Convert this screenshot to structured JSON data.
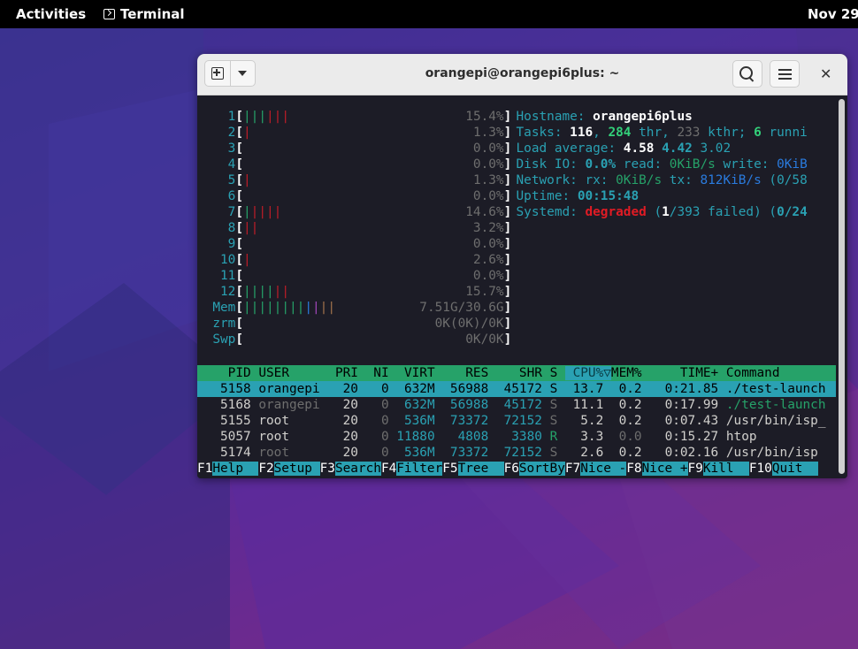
{
  "topbar": {
    "activities": "Activities",
    "app_name": "Terminal",
    "clock": "Nov 29"
  },
  "window": {
    "title": "orangepi@orangepi6plus: ~"
  },
  "cpus": [
    {
      "label": "1",
      "bars": [
        [
          "g",
          "|||"
        ],
        [
          "r",
          "|||"
        ]
      ],
      "pct": "15.4%"
    },
    {
      "label": "2",
      "bars": [
        [
          "r",
          "|"
        ]
      ],
      "pct": "1.3%"
    },
    {
      "label": "3",
      "bars": [],
      "pct": "0.0%"
    },
    {
      "label": "4",
      "bars": [],
      "pct": "0.0%"
    },
    {
      "label": "5",
      "bars": [
        [
          "r",
          "|"
        ]
      ],
      "pct": "1.3%"
    },
    {
      "label": "6",
      "bars": [],
      "pct": "0.0%"
    },
    {
      "label": "7",
      "bars": [
        [
          "g",
          "|"
        ],
        [
          "r",
          "||||"
        ]
      ],
      "pct": "14.6%"
    },
    {
      "label": "8",
      "bars": [
        [
          "r",
          "||"
        ]
      ],
      "pct": "3.2%"
    },
    {
      "label": "9",
      "bars": [],
      "pct": "0.0%"
    },
    {
      "label": "10",
      "bars": [
        [
          "r",
          "|"
        ]
      ],
      "pct": "2.6%"
    },
    {
      "label": "11",
      "bars": [],
      "pct": "0.0%"
    },
    {
      "label": "12",
      "bars": [
        [
          "g",
          "||||"
        ],
        [
          "r",
          "||"
        ]
      ],
      "pct": "15.7%"
    }
  ],
  "meters": [
    {
      "label": "Mem",
      "bars": [
        [
          "g",
          "||||||||"
        ],
        [
          "b",
          "|"
        ],
        [
          "m",
          "|"
        ],
        [
          "y",
          "||"
        ]
      ],
      "value": "7.51G/30.6G"
    },
    {
      "label": "zrm",
      "bars": [],
      "value": "0K(0K)/0K"
    },
    {
      "label": "Swp",
      "bars": [],
      "value": "0K/0K"
    }
  ],
  "info": {
    "hostname_label": "Hostname: ",
    "hostname": "orangepi6plus",
    "tasks_label": "Tasks: ",
    "tasks": "116",
    "threads": "284",
    "thr_label": " thr, ",
    "kthreads": "233",
    "kthr_label": " kthr; ",
    "running": "6",
    "running_label": " runni",
    "load_label": "Load average: ",
    "load1": "4.58",
    "load5": "4.42",
    "load15": "3.02",
    "disk_label": "Disk IO: ",
    "disk_pct": "0.0%",
    "disk_read_label": " read: ",
    "disk_read": "0KiB/s",
    "disk_write_label": " write: ",
    "disk_write": "0KiB",
    "net_label": "Network: rx: ",
    "net_rx": "0KiB/s",
    "net_tx_label": " tx: ",
    "net_tx": "812KiB/s",
    "net_pkts_open": " (",
    "net_pkts": "0/58",
    "uptime_label": "Uptime: ",
    "uptime": "00:15:48",
    "systemd_label": "Systemd: ",
    "systemd_state": "degraded",
    "systemd_open": " (",
    "systemd_failed": "1",
    "systemd_total": "/393",
    "systemd_failed_label": " failed) (",
    "systemd_jobs": "0/24"
  },
  "table": {
    "headers": {
      "pid": "PID",
      "user": "USER",
      "pri": "PRI",
      "ni": "NI",
      "virt": "VIRT",
      "res": "RES",
      "shr": "SHR",
      "s": "S",
      "cpu": "CPU%▽",
      "mem": "MEM%",
      "time": "TIME+",
      "command": "Command"
    },
    "rows": [
      {
        "pid": "5158",
        "user": "orangepi",
        "pri": "20",
        "ni": "0",
        "virt": "632M",
        "res": "56988",
        "shr": "45172",
        "s": "S",
        "cpu": "13.7",
        "mem": "0.2",
        "time": "0:21.85",
        "command": "./test-launch",
        "selected": true,
        "thread": false
      },
      {
        "pid": "5168",
        "user": "orangepi",
        "pri": "20",
        "ni": "0",
        "virt": "632M",
        "res": "56988",
        "shr": "45172",
        "s": "S",
        "cpu": "11.1",
        "mem": "0.2",
        "time": "0:17.99",
        "command": "./test-launch",
        "selected": false,
        "thread": true
      },
      {
        "pid": "5155",
        "user": "root",
        "pri": "20",
        "ni": "0",
        "virt": "536M",
        "res": "73372",
        "shr": "72152",
        "s": "S",
        "cpu": "5.2",
        "mem": "0.2",
        "time": "0:07.43",
        "command": "/usr/bin/isp_",
        "selected": false,
        "thread": false
      },
      {
        "pid": "5057",
        "user": "root",
        "pri": "20",
        "ni": "0",
        "virt": "11880",
        "res": "4808",
        "shr": "3380",
        "s": "R",
        "cpu": "3.3",
        "mem": "0.0",
        "time": "0:15.27",
        "command": "htop",
        "selected": false,
        "thread": false
      },
      {
        "pid": "5174",
        "user": "root",
        "pri": "20",
        "ni": "0",
        "virt": "536M",
        "res": "73372",
        "shr": "72152",
        "s": "S",
        "cpu": "2.6",
        "mem": "0.2",
        "time": "0:02.16",
        "command": "/usr/bin/isp",
        "selected": false,
        "thread": true
      }
    ]
  },
  "fkeys": [
    {
      "key": "F1",
      "label": "Help  "
    },
    {
      "key": "F2",
      "label": "Setup "
    },
    {
      "key": "F3",
      "label": "Search"
    },
    {
      "key": "F4",
      "label": "Filter"
    },
    {
      "key": "F5",
      "label": "Tree  "
    },
    {
      "key": "F6",
      "label": "SortBy"
    },
    {
      "key": "F7",
      "label": "Nice -"
    },
    {
      "key": "F8",
      "label": "Nice +"
    },
    {
      "key": "F9",
      "label": "Kill  "
    },
    {
      "key": "F10",
      "label": "Quit  "
    }
  ],
  "colors": {
    "cyan": "#2aa1b3",
    "green": "#26a269",
    "red": "#c01c28",
    "blue": "#2a7bde",
    "magenta": "#a347ba",
    "yellow": "#a2734c"
  }
}
